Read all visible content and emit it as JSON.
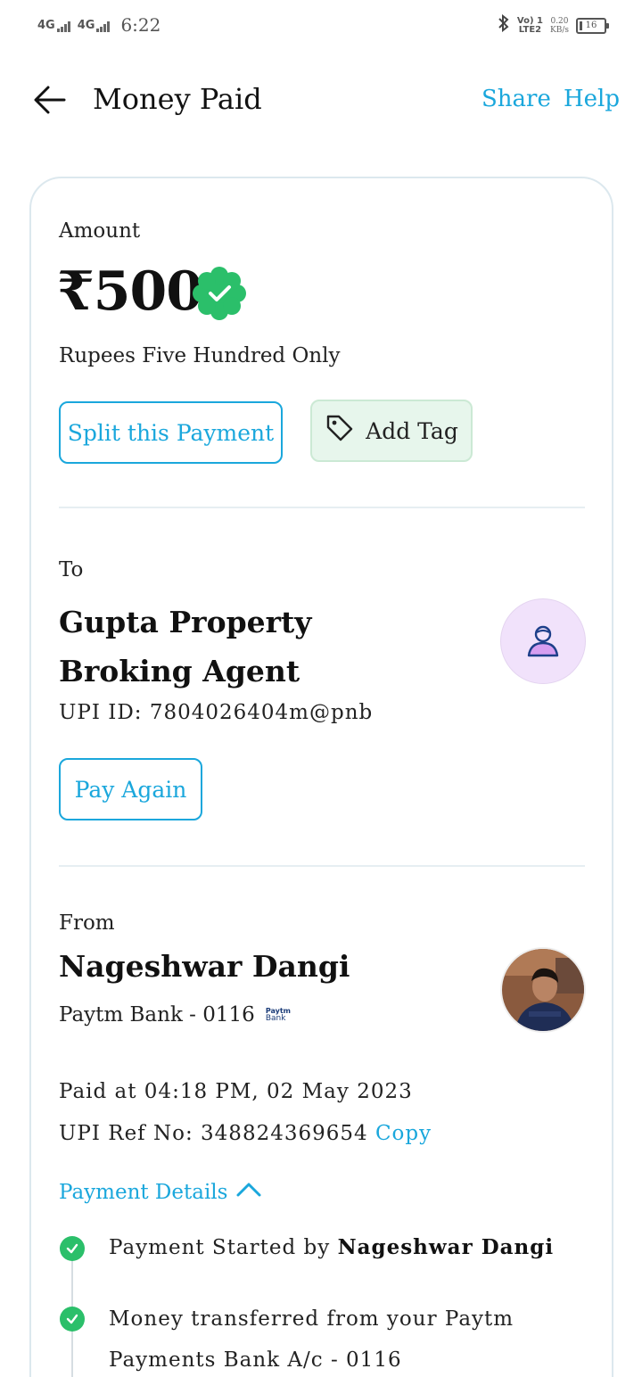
{
  "status_bar": {
    "network1": "4G",
    "network2": "4G",
    "time": "6:22",
    "volte_line1": "Vo) 1",
    "volte_line2": "LTE2",
    "speed_value": "0.20",
    "speed_unit": "KB/s",
    "battery": "16"
  },
  "header": {
    "title": "Money Paid",
    "share": "Share",
    "help": "Help"
  },
  "amount": {
    "label": "Amount",
    "value": "₹500",
    "words": "Rupees Five Hundred Only",
    "split_button": "Split this Payment",
    "tag_button": "Add Tag"
  },
  "to": {
    "label": "To",
    "name": "Gupta Property Broking Agent",
    "upi_id": "UPI ID: 7804026404m@pnb",
    "pay_again": "Pay Again"
  },
  "from": {
    "label": "From",
    "name": "Nageshwar Dangi",
    "bank": "Paytm Bank - 0116",
    "bank_logo_top": "Paytm",
    "bank_logo_bottom": "Bank"
  },
  "details": {
    "paid_at": "Paid at 04:18 PM, 02 May 2023",
    "ref_label": "UPI Ref No: 348824369654",
    "copy": "Copy",
    "payment_details": "Payment Details",
    "step1_prefix": "Payment Started by",
    "step1_name": "Nageshwar Dangi",
    "step2": "Money transferred from your Paytm Payments Bank A/c - 0116"
  },
  "colors": {
    "accent": "#1aa7dc",
    "success": "#2bbf6a",
    "tag_bg": "#e7f6ec",
    "avatar_bg": "#f1e2fb"
  }
}
